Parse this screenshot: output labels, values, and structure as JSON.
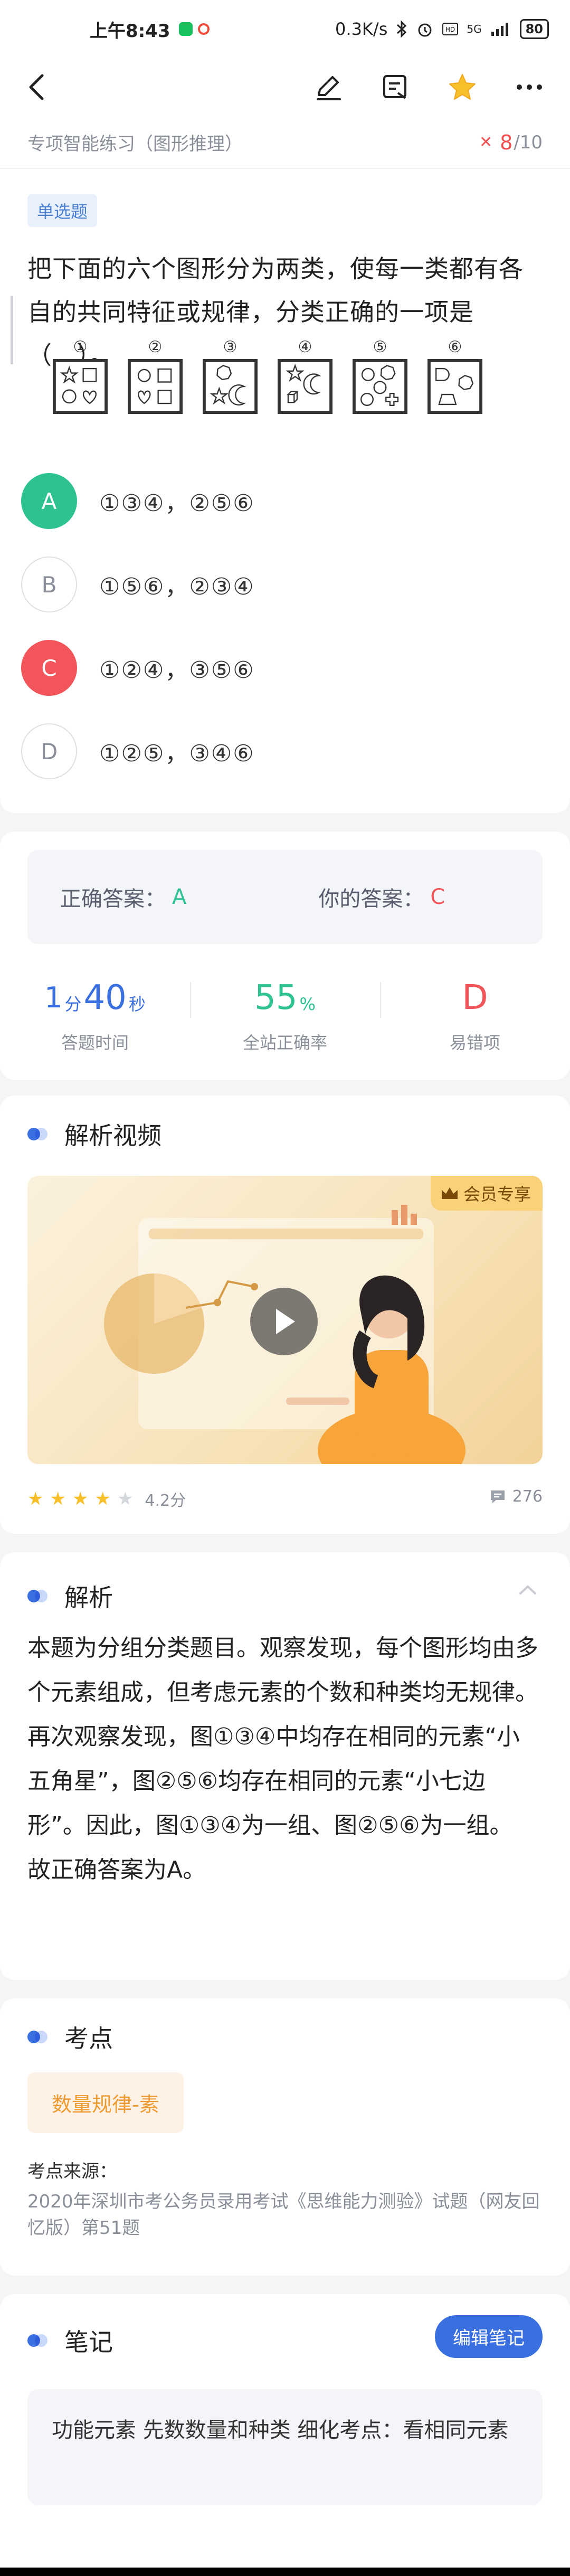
{
  "status": {
    "time": "上午8:43",
    "speed": "0.3K/s",
    "network": "5G",
    "battery": "80"
  },
  "header": {
    "subtitle": "专项智能练习（图形推理）",
    "progress_current": "8",
    "progress_total": "/10"
  },
  "question": {
    "type_tag": "单选题",
    "stem": "把下面的六个图形分为两类，使每一类都有各自的共同特征或规律，分类正确的一项是（　）。",
    "figure_numbers": [
      "①",
      "②",
      "③",
      "④",
      "⑤",
      "⑥"
    ],
    "options": [
      {
        "letter": "A",
        "text": "①③④，②⑤⑥",
        "state": "correct"
      },
      {
        "letter": "B",
        "text": "①⑤⑥，②③④",
        "state": "none"
      },
      {
        "letter": "C",
        "text": "①②④，③⑤⑥",
        "state": "selected-wrong"
      },
      {
        "letter": "D",
        "text": "①②⑤，③④⑥",
        "state": "none"
      }
    ]
  },
  "answer": {
    "correct_label": "正确答案：",
    "correct_value": "A",
    "yours_label": "你的答案：",
    "yours_value": "C",
    "time_min": "1",
    "time_min_unit": "分",
    "time_sec": "40",
    "time_sec_unit": "秒",
    "time_label": "答题时间",
    "rate": "55",
    "rate_unit": "%",
    "rate_label": "全站正确率",
    "error_prone": "D",
    "error_label": "易错项"
  },
  "video": {
    "title": "解析视频",
    "vip_label": "会员专享",
    "rating": "4.2分",
    "stars_filled": 4,
    "stars_total": 5,
    "comments": "276"
  },
  "explanation": {
    "title": "解析",
    "body": "本题为分组分类题目。观察发现，每个图形均由多个元素组成，但考虑元素的个数和种类均无规律。再次观察发现，图①③④中均存在相同的元素“小五角星”，图②⑤⑥均存在相同的元素“小七边形”。因此，图①③④为一组、图②⑤⑥为一组。",
    "conclusion": "故正确答案为A。"
  },
  "kaodian": {
    "title": "考点",
    "tag": "数量规律-素",
    "source_label": "考点来源：",
    "source_value": "2020年深圳市考公务员录用考试《思维能力测验》试题（网友回忆版）第51题"
  },
  "notes": {
    "title": "笔记",
    "edit_label": "编辑笔记",
    "content": "功能元素 先数数量和种类 细化考点：看相同元素"
  },
  "colors": {
    "accent": "#3a6fe0",
    "correct": "#2ec293",
    "wrong": "#f2555a",
    "star": "#f7bf2a"
  }
}
